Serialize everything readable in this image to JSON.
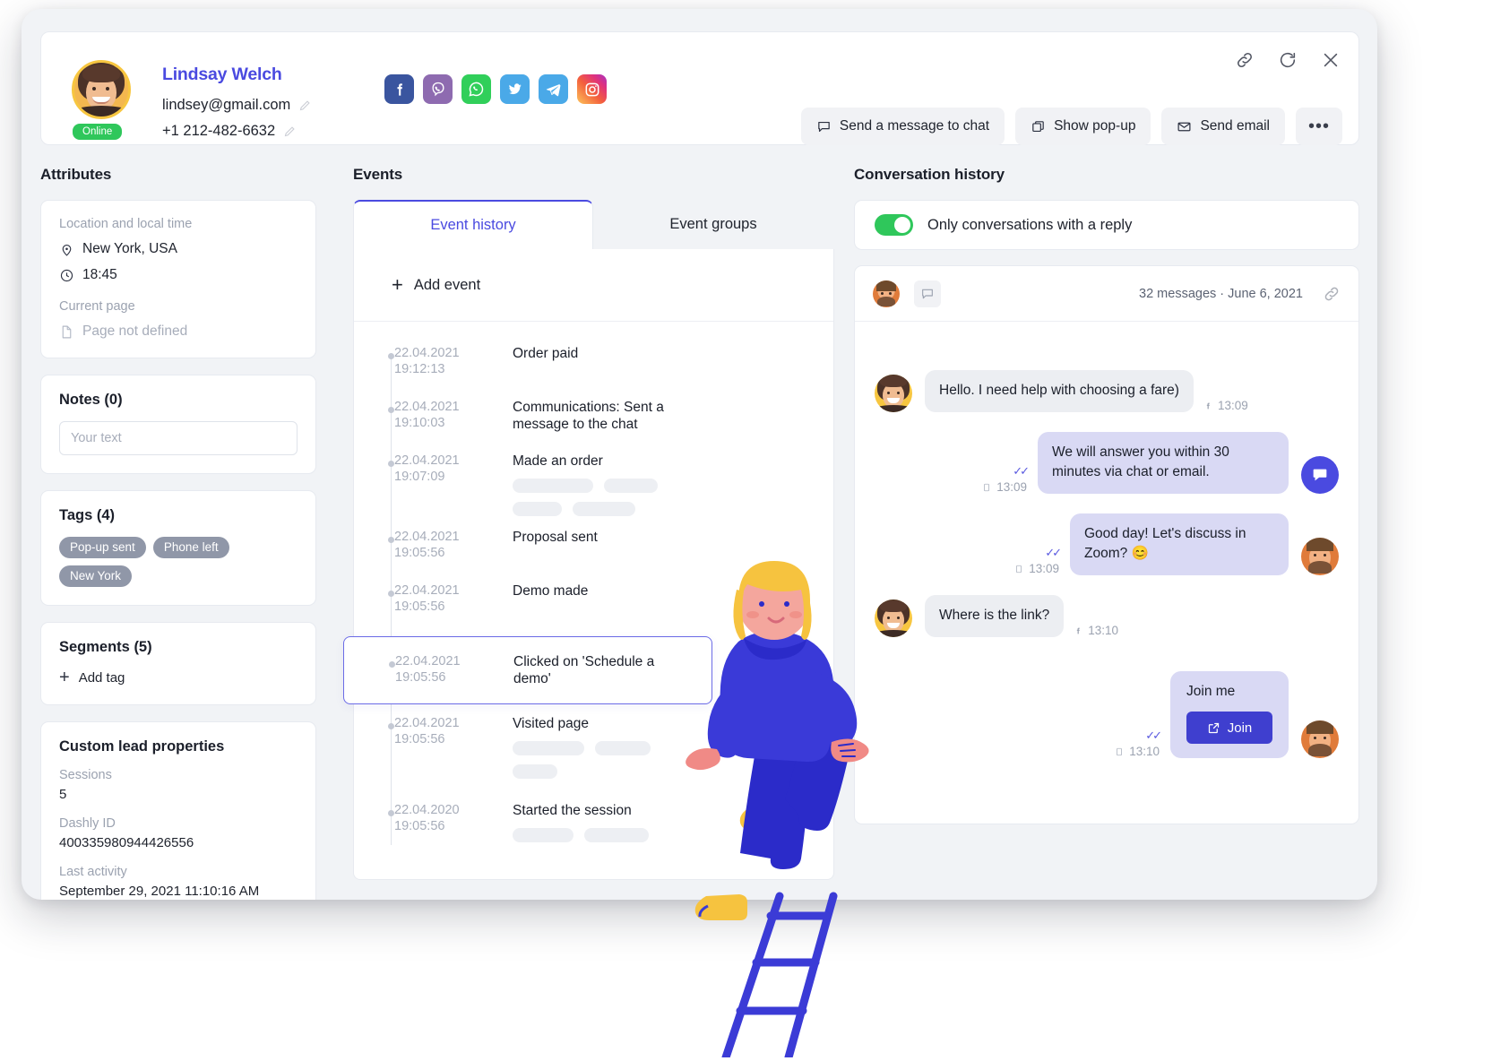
{
  "header": {
    "name": "Lindsay Welch",
    "email": "lindsey@gmail.com",
    "phone": "+1 212-482-6632",
    "status": "Online",
    "socials": [
      "facebook-icon",
      "viber-icon",
      "whatsapp-icon",
      "twitter-icon",
      "telegram-icon",
      "instagram-icon"
    ],
    "actions": {
      "send_chat": "Send a message to chat",
      "show_popup": "Show pop-up",
      "send_email": "Send email",
      "more": "•••"
    },
    "top_icons": [
      "link-icon",
      "refresh-icon",
      "close-icon"
    ]
  },
  "attributes": {
    "title": "Attributes",
    "location_label": "Location and local time",
    "location_value": "New York, USA",
    "time_value": "18:45",
    "current_page_label": "Current page",
    "current_page_value": "Page not defined",
    "notes_title": "Notes (0)",
    "notes_placeholder": "Your text",
    "notes_value": "",
    "tags_title": "Tags (4)",
    "tags": [
      "Pop-up sent",
      "Phone left",
      "New York"
    ],
    "segments_title": "Segments (5)",
    "add_tag": "Add tag",
    "custom_title": "Custom lead properties",
    "properties": [
      {
        "key": "Sessions",
        "value": "5"
      },
      {
        "key": "Dashly ID",
        "value": "400335980944426556"
      },
      {
        "key": "Last activity",
        "value": "September 29, 2021 11:10:16 AM"
      }
    ]
  },
  "events": {
    "title": "Events",
    "tabs": [
      {
        "label": "Event history",
        "active": true
      },
      {
        "label": "Event groups",
        "active": false
      }
    ],
    "add_event": "Add event",
    "items": [
      {
        "date": "22.04.2021",
        "time": "19:12:13",
        "title": "Order paid",
        "skeletons": [],
        "selected": false
      },
      {
        "date": "22.04.2021",
        "time": "19:10:03",
        "title": "Communications: Sent a message to the chat",
        "skeletons": [],
        "selected": false
      },
      {
        "date": "22.04.2021",
        "time": "19:07:09",
        "title": "Made an order",
        "skeletons": [
          [
            90,
            60
          ],
          [
            55,
            70
          ]
        ],
        "selected": false
      },
      {
        "date": "22.04.2021",
        "time": "19:05:56",
        "title": "Proposal sent",
        "skeletons": [],
        "selected": false
      },
      {
        "date": "22.04.2021",
        "time": "19:05:56",
        "title": "Demo made",
        "skeletons": [],
        "selected": false
      },
      {
        "date": "22.04.2021",
        "time": "19:05:56",
        "title": "Clicked on 'Schedule a demo'",
        "skeletons": [],
        "selected": true
      },
      {
        "date": "22.04.2021",
        "time": "19:05:56",
        "title": "Visited page",
        "skeletons": [
          [
            80,
            62
          ],
          [
            50
          ]
        ],
        "selected": false
      },
      {
        "date": "22.04.2020",
        "time": "19:05:56",
        "title": "Started the session",
        "skeletons": [
          [
            68,
            72
          ]
        ],
        "selected": false
      }
    ]
  },
  "conversation": {
    "title": "Conversation history",
    "toggle_label": "Only conversations with a reply",
    "toggle_on": true,
    "meta": "32 messages · June 6, 2021",
    "messages": [
      {
        "side": "in",
        "avatar": "female-avatar",
        "text": "Hello. I need help with choosing a fare)",
        "channel": "facebook-icon",
        "time": "13:09",
        "read": false
      },
      {
        "side": "out",
        "avatar": "bot-avatar",
        "text": "We will answer you within 30 minutes via chat or email.",
        "channel": "mobile-icon",
        "time": "13:09",
        "read": true
      },
      {
        "side": "out",
        "avatar": "male-avatar",
        "text": "Good day! Let's discuss in Zoom? 😊",
        "channel": "mobile-icon",
        "time": "13:09",
        "read": true
      },
      {
        "side": "in",
        "avatar": "female-avatar",
        "text": "Where is the link?",
        "channel": "facebook-icon",
        "time": "13:10",
        "read": false
      },
      {
        "side": "out",
        "avatar": "male-avatar",
        "text": "Join me",
        "button_label": "Join",
        "channel": "mobile-icon",
        "time": "13:10",
        "read": true
      }
    ]
  },
  "colors": {
    "accent": "#4a4ae0",
    "green": "#2fc75b",
    "bubble_in": "#eceef2",
    "bubble_out": "#d9d9f4",
    "panel_bg": "#f1f3f6"
  }
}
